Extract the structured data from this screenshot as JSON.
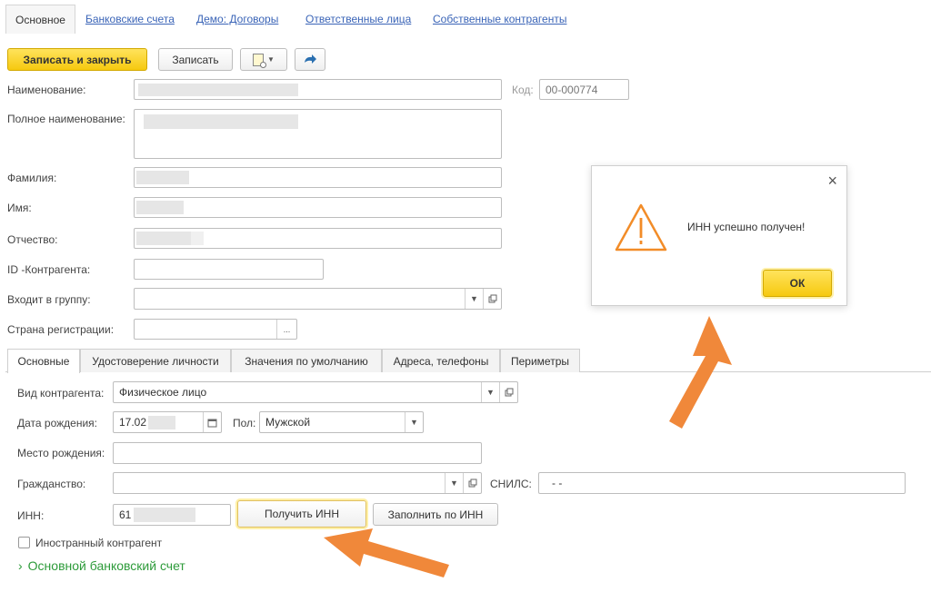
{
  "top_tabs": {
    "active": "Основное",
    "links": [
      "Банковские счета",
      "Демо: Договоры",
      "Ответственные лица",
      "Собственные контрагенты"
    ]
  },
  "toolbar": {
    "save_close": "Записать и закрыть",
    "save": "Записать"
  },
  "form": {
    "name_label": "Наименование:",
    "code_label": "Код:",
    "code_value": "00-000774",
    "fullname_label": "Полное наименование:",
    "lastname_label": "Фамилия:",
    "firstname_label": "Имя:",
    "middlename_label": "Отчество:",
    "id_label": "ID -Контрагента:",
    "group_label": "Входит в группу:",
    "country_label": "Страна регистрации:",
    "ellipsis": "..."
  },
  "inner_tabs": [
    "Основные",
    "Удостоверение личности",
    "Значения по умолчанию",
    "Адреса, телефоны",
    "Периметры"
  ],
  "details": {
    "kind_label": "Вид контрагента:",
    "kind_value": "Физическое лицо",
    "birthdate_label": "Дата рождения:",
    "birthdate_value": "17.02",
    "sex_label": "Пол:",
    "sex_value": "Мужской",
    "birthplace_label": "Место рождения:",
    "citizenship_label": "Гражданство:",
    "snils_label": "СНИЛС:",
    "snils_value": "-   -",
    "inn_label": "ИНН:",
    "inn_value": "61",
    "get_inn_button": "Получить ИНН",
    "fill_by_inn_button": "Заполнить по ИНН",
    "foreign_label": "Иностранный контрагент",
    "bank_account_section": "Основной банковский счет"
  },
  "dialog": {
    "message": "ИНН успешно получен!",
    "ok": "ОК",
    "close": "×"
  },
  "colors": {
    "accent_yellow": "#f6c90f",
    "link_blue": "#3a64b7",
    "section_green": "#2d9b3a",
    "arrow_orange": "#f0883a",
    "warning_orange": "#f28c28"
  }
}
